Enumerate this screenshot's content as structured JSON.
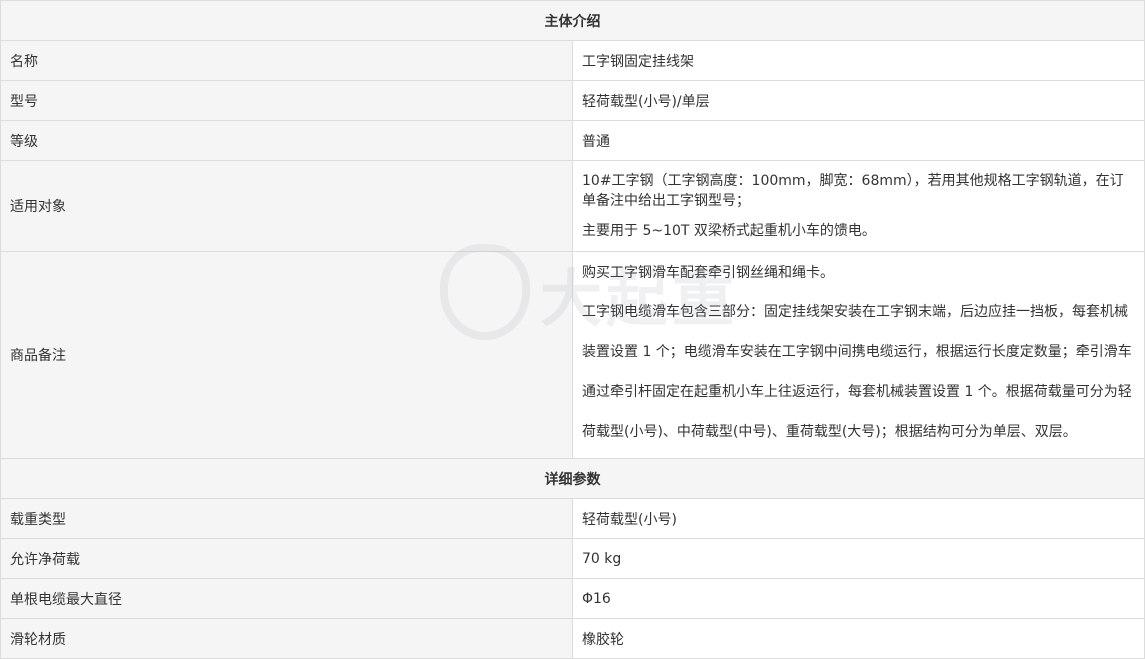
{
  "sections": {
    "main_intro": "主体介绍",
    "detail_params": "详细参数"
  },
  "intro_rows": {
    "name": {
      "label": "名称",
      "value": "工字钢固定挂线架"
    },
    "model": {
      "label": "型号",
      "value": "轻荷载型(小号)/单层"
    },
    "grade": {
      "label": "等级",
      "value": "普通"
    },
    "applicable": {
      "label": "适用对象",
      "lines": [
        "10#工字钢（工字钢高度：100mm，脚宽：68mm），若用其他规格工字钢轨道，在订单备注中给出工字钢型号；",
        "主要用于 5~10T 双梁桥式起重机小车的馈电。"
      ]
    },
    "remarks": {
      "label": "商品备注",
      "lines": [
        "购买工字钢滑车配套牵引钢丝绳和绳卡。",
        "工字钢电缆滑车包含三部分：固定挂线架安装在工字钢末端，后边应挂一挡板，每套机械装置设置 1 个；电缆滑车安装在工字钢中间携电缆运行，根据运行长度定数量；牵引滑车通过牵引杆固定在起重机小车上往返运行，每套机械装置设置 1 个。根据荷载量可分为轻荷载型(小号)、中荷载型(中号)、重荷载型(大号)；根据结构可分为单层、双层。"
      ]
    }
  },
  "detail_rows": [
    {
      "label": "载重类型",
      "value": "轻荷载型(小号)"
    },
    {
      "label": "允许净荷载",
      "value": "70 kg"
    },
    {
      "label": "单根电缆最大直径",
      "value": "Φ16"
    },
    {
      "label": "滑轮材质",
      "value": "橡胶轮"
    }
  ]
}
